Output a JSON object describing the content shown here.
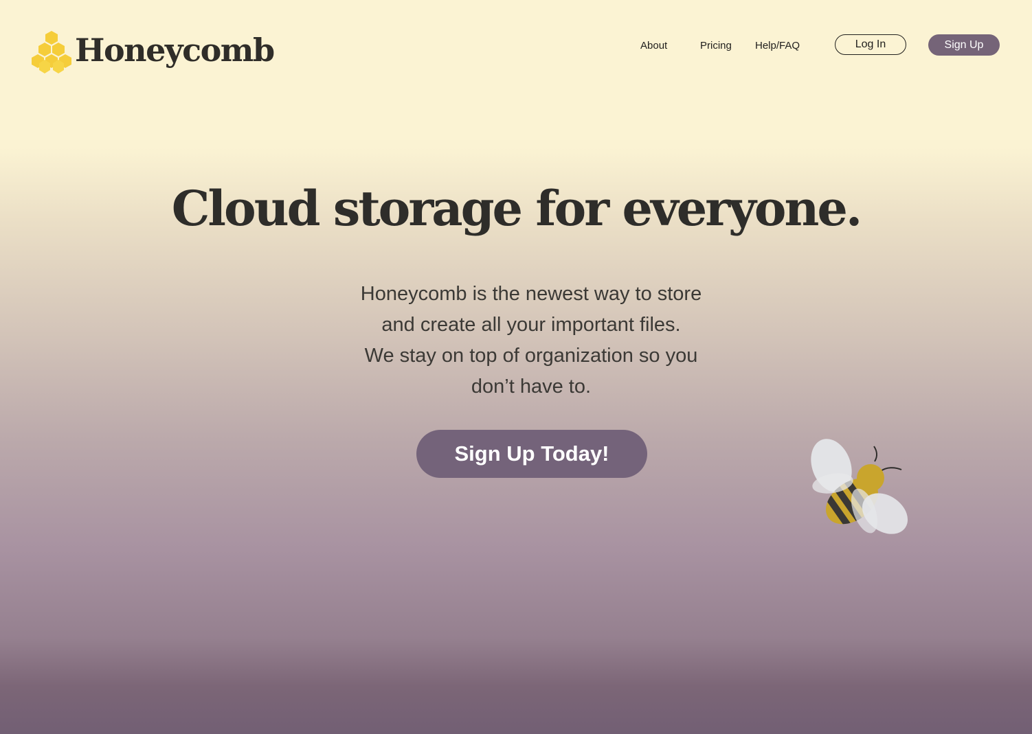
{
  "brand": {
    "name": "Honeycomb",
    "logo_icon": "honeycomb-icon",
    "logo_color": "#f5cd3a"
  },
  "nav": {
    "links": [
      "About",
      "Pricing",
      "Help/FAQ"
    ],
    "login_label": "Log In",
    "signup_label": "Sign Up"
  },
  "hero": {
    "title": "Cloud storage for everyone.",
    "body_lines": [
      "Honeycomb is the newest way to store",
      "and create all your important files.",
      "We stay on top of organization so you",
      "don’t have to."
    ],
    "cta_label": "Sign Up Today!",
    "illustration": "bee-icon"
  },
  "colors": {
    "accent": "#756478",
    "text_dark": "#2e2d2a",
    "background_top": "#fbf3d3",
    "background_bottom": "#725f74"
  }
}
